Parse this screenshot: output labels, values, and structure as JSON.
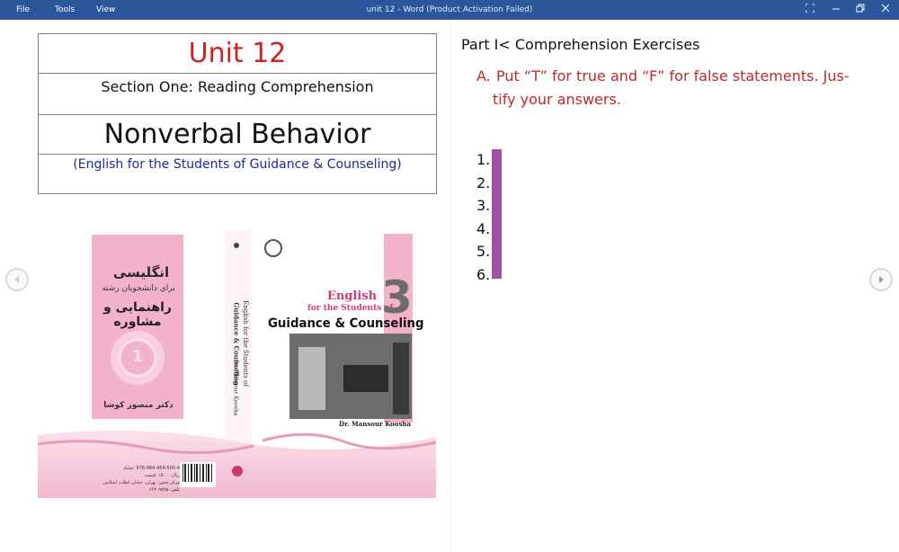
{
  "titlebar": {
    "menu": [
      "File",
      "Tools",
      "View"
    ],
    "doc_title": "unit 12 - Word (Product Activation Failed)"
  },
  "header_box": {
    "unit": "Unit 12",
    "section": "Section One: Reading Comprehension",
    "lesson": "Nonverbal Behavior",
    "course": "(English for the Students of Guidance & Counseling)"
  },
  "cover": {
    "persian_title": "انگلیسی",
    "persian_sub1": "برای دانشجویان رشته",
    "persian_sub2": "راهنمایی و مشاوره",
    "persian_author": "دکتر منصور کوشا",
    "number": "3",
    "english_line1": "English",
    "english_line2": "for the Students of",
    "english_main": "Guidance & Counseling",
    "author": "Dr. Mansour Koosha",
    "spine_line1": "English for the Students of",
    "spine_line2": "Guidance & Counseling",
    "spine_author": "Dr. Mansour Koosha",
    "emblem_number": "1",
    "isbn": "978-964-459-500-4 :شابک",
    "price": "ریال ۱۵۰۰۰ :قیمت",
    "publisher_addr": "مرکز پخش: تهران، خیابان انقلاب اسلامی",
    "publisher_tel": "تلفن: ۶۶۴۰۹۵۹۵"
  },
  "exercise": {
    "part_heading": "Part I< Comprehension Exercises",
    "letter": "A.",
    "instruction_line1": "Put “T” for true and “F” for false statements. Jus-",
    "instruction_line2": "tify your answers.",
    "items": [
      "1.",
      "2.",
      "3.",
      "4.",
      "5.",
      "6."
    ]
  },
  "colors": {
    "titlebar": "#2b579a",
    "unit_red": "#cc2222",
    "instruction_red": "#c0282d",
    "course_blue": "#1a2a9a",
    "highlight_purple": "#a150a6",
    "cover_pink": "#f2b8cf"
  },
  "icons": [
    "fullscreen-icon",
    "minimize-icon",
    "restore-icon",
    "close-icon",
    "prev-page-icon",
    "next-page-icon"
  ]
}
